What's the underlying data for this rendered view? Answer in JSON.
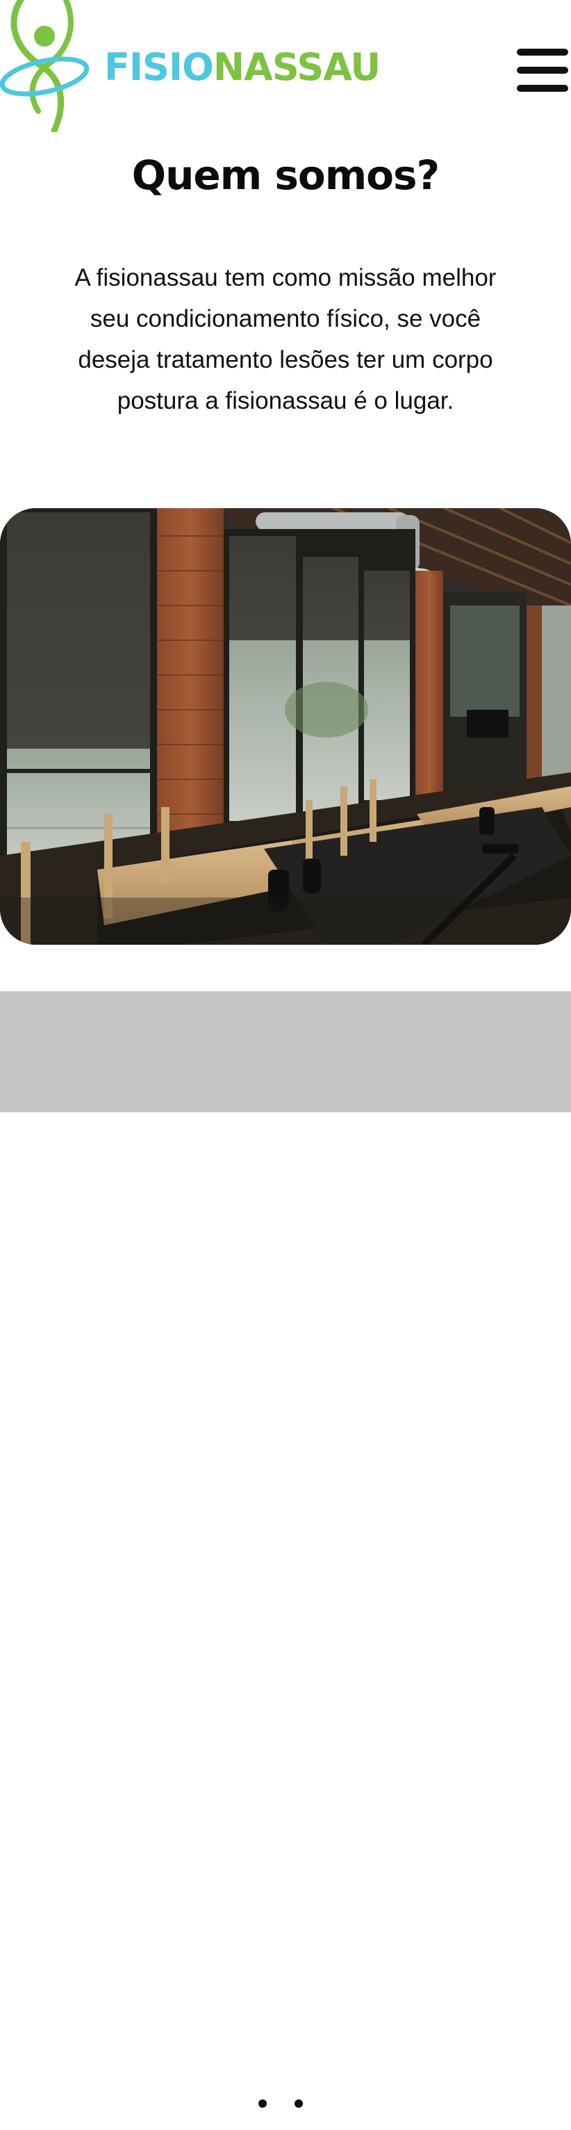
{
  "brand": {
    "name_part1": "FISIO",
    "name_part2": "NASSAU",
    "color_primary": "#4ec7e0",
    "color_secondary": "#7dc242"
  },
  "header": {
    "menu_icon": "hamburger-menu-icon"
  },
  "about": {
    "title": "Quem somos?",
    "description": "A fisionassau tem como missão melhor seu condicionamento físico, se você deseja tratamento lesões ter um corpo postura a fisionassau é o lugar."
  },
  "image": {
    "subject": "pilates-studio-photo"
  },
  "colors": {
    "section_bg": "#c4c4c4",
    "card_bg": "#ffffff"
  }
}
